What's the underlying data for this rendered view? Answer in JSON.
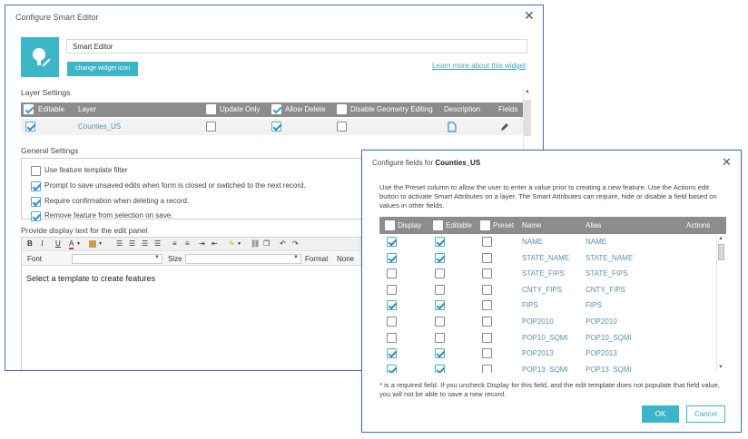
{
  "main_dialog": {
    "title": "Configure Smart Editor",
    "widget_name": "Smart Editor",
    "change_icon_label": "change widget icon",
    "learn_more_label": "Learn more about this widget",
    "layer_settings_label": "Layer Settings",
    "layer_table": {
      "headers": {
        "editable": "Editable",
        "layer": "Layer",
        "update_only": "Update Only",
        "allow_delete": "Allow Delete",
        "disable_geometry": "Disable Geometry Editing",
        "description": "Description",
        "fields": "Fields"
      },
      "header_checks": {
        "editable": true,
        "update_only": false,
        "allow_delete": true,
        "disable_geometry": false
      },
      "row": {
        "layer": "Counties_US",
        "editable": true,
        "update_only": false,
        "allow_delete": true,
        "disable_geometry": false
      }
    },
    "general_settings_label": "General Settings",
    "general_settings": [
      {
        "label": "Use feature template filter",
        "checked": false
      },
      {
        "label": "Prompt to save unsaved edits when form is closed or switched to the next record.",
        "checked": true
      },
      {
        "label": "Require confirmation when deleting a record.",
        "checked": true
      },
      {
        "label": "Remove feature from selection on save.",
        "checked": true
      }
    ],
    "display_text_label": "Provide display text for the edit panel",
    "editor": {
      "toolbar": {
        "bold": "B",
        "italic": "I",
        "underline": "U",
        "font_color": "A"
      },
      "font_label": "Font",
      "size_label": "Size",
      "format_label": "Format",
      "format_value": "None",
      "content": "Select a template to create features"
    }
  },
  "fields_dialog": {
    "title_prefix": "Configure fields for ",
    "layer_name": "Counties_US",
    "description": "Use the Preset column to allow the user to enter a value prior to creating a new feature. Use the Actions edit button to activate Smart Attributes on a layer. The Smart Attributes can require, hide or disable a field based on values in other fields.",
    "headers": {
      "display": "Display",
      "editable": "Editable",
      "preset": "Preset",
      "name": "Name",
      "alias": "Alias",
      "actions": "Actions"
    },
    "rows": [
      {
        "name": "NAME",
        "alias": "NAME",
        "display": true,
        "editable": true,
        "preset": false
      },
      {
        "name": "STATE_NAME",
        "alias": "STATE_NAME",
        "display": true,
        "editable": true,
        "preset": false
      },
      {
        "name": "STATE_FIPS",
        "alias": "STATE_FIPS",
        "display": false,
        "editable": false,
        "preset": false
      },
      {
        "name": "CNTY_FIPS",
        "alias": "CNTY_FIPS",
        "display": false,
        "editable": false,
        "preset": false
      },
      {
        "name": "FIPS",
        "alias": "FIPS",
        "display": true,
        "editable": true,
        "preset": false
      },
      {
        "name": "POP2010",
        "alias": "POP2010",
        "display": false,
        "editable": false,
        "preset": false
      },
      {
        "name": "POP10_SQMI",
        "alias": "POP10_SQMI",
        "display": false,
        "editable": false,
        "preset": false
      },
      {
        "name": "POP2013",
        "alias": "POP2013",
        "display": true,
        "editable": true,
        "preset": false
      },
      {
        "name": "POP13_SQMI",
        "alias": "POP13_SQMI",
        "display": true,
        "editable": true,
        "preset": false
      }
    ],
    "footnote": "* is a required field. If you uncheck Display for this field, and the edit template does not populate that field value, you will not be able to save a new record.",
    "ok_label": "OK",
    "cancel_label": "Cancel"
  },
  "colors": {
    "accent": "#3bb6c9",
    "header_gray": "#8c8c8c",
    "link": "#3aa6c9",
    "dialog_border": "#3f6fb5"
  }
}
